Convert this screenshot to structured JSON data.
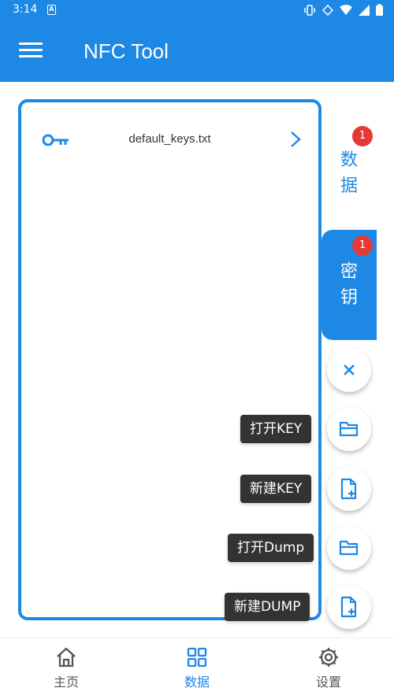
{
  "status_bar": {
    "time": "3:14",
    "notif_icon": "A"
  },
  "app_bar": {
    "title": "NFC Tool"
  },
  "file_list": {
    "items": [
      {
        "name": "default_keys.txt"
      }
    ]
  },
  "side_tabs": {
    "data": {
      "label_1": "数",
      "label_2": "据",
      "badge": "1"
    },
    "key": {
      "label_1": "密",
      "label_2": "钥",
      "badge": "1"
    }
  },
  "fab_actions": {
    "open_key": "打开KEY",
    "new_key": "新建KEY",
    "open_dump": "打开Dump",
    "new_dump": "新建DUMP"
  },
  "bottom_nav": {
    "home": "主页",
    "data": "数据",
    "settings": "设置"
  },
  "colors": {
    "primary": "#1e88e5",
    "badge": "#e53935",
    "tooltip": "#333333"
  }
}
